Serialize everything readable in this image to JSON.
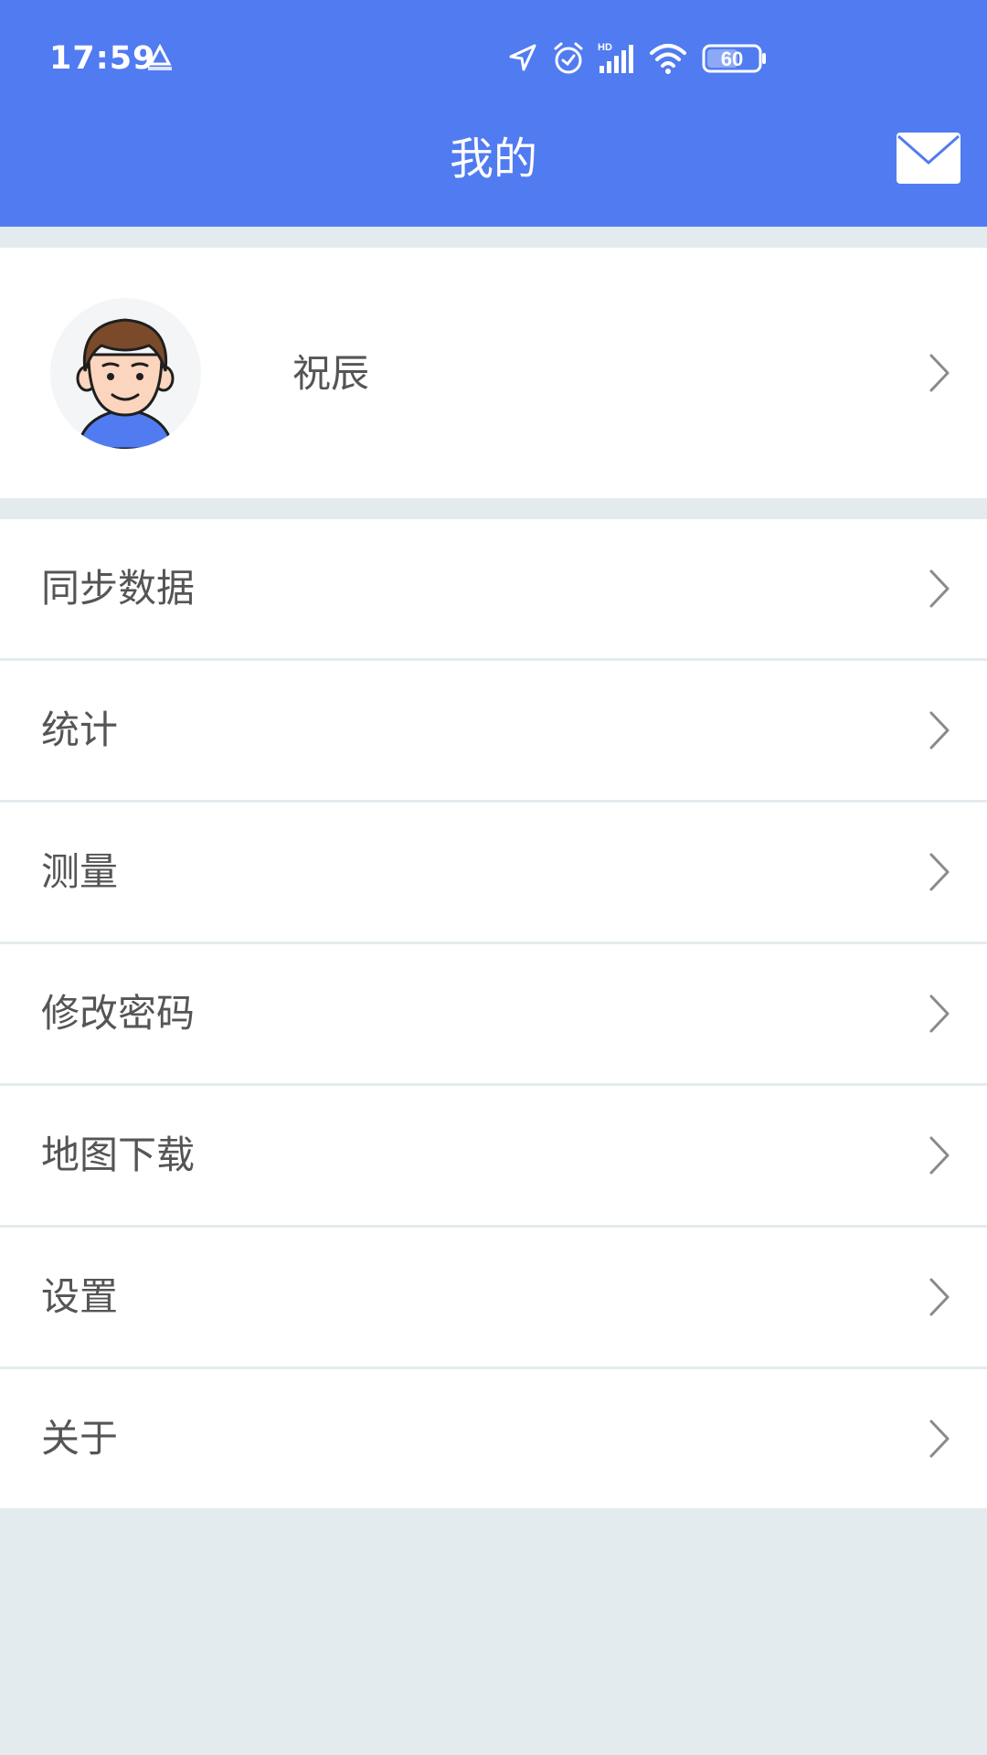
{
  "status_bar": {
    "time": "17:59",
    "app_badge_icon": "patrol-logo-icon",
    "icons": [
      "location-arrow-icon",
      "alarm-clock-icon",
      "hd-signal-icon",
      "wifi-icon",
      "battery-icon"
    ],
    "network_label": "HD",
    "battery_level": "60"
  },
  "header": {
    "title": "我的",
    "mail_icon": "mail-icon",
    "background_color": "#517bf0"
  },
  "profile": {
    "name": "祝辰",
    "avatar_icon": "avatar-icon"
  },
  "menu": {
    "items": [
      {
        "label": "同步数据",
        "icon": "chevron-right-icon"
      },
      {
        "label": "统计",
        "icon": "chevron-right-icon"
      },
      {
        "label": "测量",
        "icon": "chevron-right-icon"
      },
      {
        "label": "修改密码",
        "icon": "chevron-right-icon"
      },
      {
        "label": "地图下载",
        "icon": "chevron-right-icon"
      },
      {
        "label": "设置",
        "icon": "chevron-right-icon"
      },
      {
        "label": "关于",
        "icon": "chevron-right-icon"
      }
    ]
  },
  "colors": {
    "accent": "#517bf0",
    "page_background": "#e4ebee",
    "text": "#555555",
    "chevron": "#8a8a8a"
  }
}
